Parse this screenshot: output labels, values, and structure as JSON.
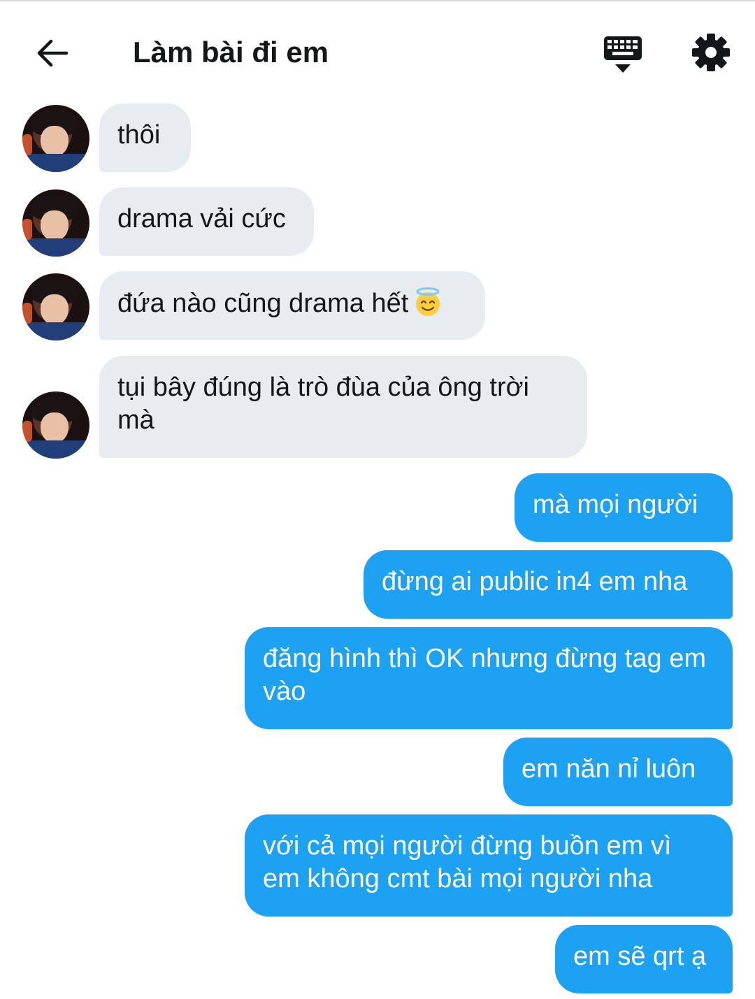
{
  "header": {
    "title": "Làm bài đi em",
    "back_icon": "arrow-left-icon",
    "keyboard_icon": "keyboard-icon",
    "settings_icon": "gear-icon"
  },
  "colors": {
    "incoming_bubble": "#e6ecf0",
    "outgoing_bubble": "#1da1f2",
    "text_dark": "#14171a",
    "text_light": "#ffffff"
  },
  "messages": [
    {
      "direction": "in",
      "text": "thôi"
    },
    {
      "direction": "in",
      "text": "drama vải cức"
    },
    {
      "direction": "in",
      "text": "đứa nào cũng drama hết",
      "emoji": "smiling-face-with-halo-emoji"
    },
    {
      "direction": "in",
      "text": "tụi bây đúng là trò đùa của ông trời mà"
    },
    {
      "direction": "out",
      "text": "mà mọi người"
    },
    {
      "direction": "out",
      "text": "đừng ai public in4 em nha"
    },
    {
      "direction": "out",
      "text": "đăng hình thì OK nhưng đừng tag em vào"
    },
    {
      "direction": "out",
      "text": "em năn nỉ luôn"
    },
    {
      "direction": "out",
      "text": "với cả mọi người đừng buồn em vì em không cmt bài mọi người nha"
    },
    {
      "direction": "out",
      "text": "em sẽ qrt ạ"
    }
  ]
}
